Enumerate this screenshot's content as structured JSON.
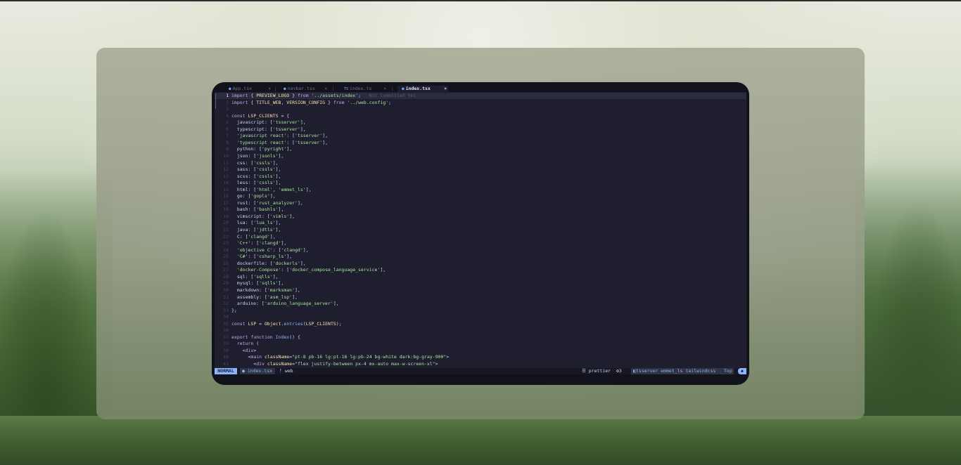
{
  "tabs": [
    {
      "icon": "react-icon",
      "label": "App.tsx",
      "close": "×"
    },
    {
      "icon": "react-icon",
      "label": "navbar.tsx",
      "close": "×"
    },
    {
      "icon": "typescript-icon",
      "icon_text": "TS",
      "label": "index.ts",
      "close": "×"
    },
    {
      "icon": "react-icon",
      "label": "index.tsx",
      "close": "×",
      "active": true
    }
  ],
  "code_lines": [
    {
      "n": "1",
      "text": "import { PREVIEW_LOGO } from '../assets/index';",
      "hint": "Not Committed Yet"
    },
    {
      "n": "2",
      "text": "import { TITLE_WEB, VERSION_CONFIG } from '../web.config';"
    },
    {
      "n": "3",
      "text": ""
    },
    {
      "n": "4",
      "text": "const LSP_CLIENTS = {"
    },
    {
      "n": "5",
      "text": "  javascript: ['tsserver'],"
    },
    {
      "n": "6",
      "text": "  typescript: ['tsserver'],"
    },
    {
      "n": "7",
      "text": "  'javascript react': ['tsserver'],"
    },
    {
      "n": "8",
      "text": "  'typescript react': ['tsserver'],"
    },
    {
      "n": "9",
      "text": "  python: ['pyright'],"
    },
    {
      "n": "10",
      "text": "  json: ['jsonls'],"
    },
    {
      "n": "11",
      "text": "  css: ['cssls'],"
    },
    {
      "n": "12",
      "text": "  sass: ['cssls'],"
    },
    {
      "n": "13",
      "text": "  scss: ['cssls'],"
    },
    {
      "n": "14",
      "text": "  less: ['cssls'],"
    },
    {
      "n": "15",
      "text": "  html: ['html', 'emmet_ls'],"
    },
    {
      "n": "16",
      "text": "  go: ['gopls'],"
    },
    {
      "n": "17",
      "text": "  rust: ['rust_analyzer'],"
    },
    {
      "n": "18",
      "text": "  bash: ['bashls'],"
    },
    {
      "n": "19",
      "text": "  vimscript: ['vimls'],"
    },
    {
      "n": "20",
      "text": "  lua: ['lua_ls'],"
    },
    {
      "n": "21",
      "text": "  java: ['jdtls'],"
    },
    {
      "n": "22",
      "text": "  C: ['clangd'],"
    },
    {
      "n": "23",
      "text": "  'C++': ['clangd'],"
    },
    {
      "n": "24",
      "text": "  'objective C': ['clangd'],"
    },
    {
      "n": "25",
      "text": "  'C#': ['csharp_ls'],"
    },
    {
      "n": "26",
      "text": "  dockerfile: ['dockerls'],"
    },
    {
      "n": "27",
      "text": "  'docker-Compose': ['docker_compose_language_service'],"
    },
    {
      "n": "28",
      "text": "  sql: ['sqlls'],"
    },
    {
      "n": "29",
      "text": "  mysql: ['sqlls'],"
    },
    {
      "n": "30",
      "text": "  markdown: ['marksman'],"
    },
    {
      "n": "31",
      "text": "  assembly: ['asm_lsp'],"
    },
    {
      "n": "32",
      "text": "  arduino: ['arduino_language_server'],"
    },
    {
      "n": "33",
      "text": "};"
    },
    {
      "n": "34",
      "text": ""
    },
    {
      "n": "35",
      "text": "const LSP = Object.entries(LSP_CLIENTS);"
    },
    {
      "n": "36",
      "text": ""
    },
    {
      "n": "37",
      "text": "export function Index() {"
    },
    {
      "n": "38",
      "text": "  return ("
    },
    {
      "n": "39",
      "text": "    <div>"
    },
    {
      "n": "40",
      "text": "      <main className=\"pt-8 pb-16 lg:pt-16 lg:pb-24 bg-white dark:bg-gray-900\">"
    },
    {
      "n": "41",
      "text": "        <div className=\"flex justify-between px-4 mx-auto max-w-screen-xl\">"
    }
  ],
  "statusbar": {
    "mode": "NORMAL",
    "file": "index.tsx",
    "branch": "web",
    "formatter": "prettier",
    "diagnostics": "3",
    "lsp": "tsserver emmet_ls tailwindcss",
    "position": "Top"
  },
  "colors": {
    "accent": "#89b4fa",
    "editor_bg": "#1e1e2e",
    "string": "#a6e3a1",
    "keyword": "#cba6f7"
  }
}
